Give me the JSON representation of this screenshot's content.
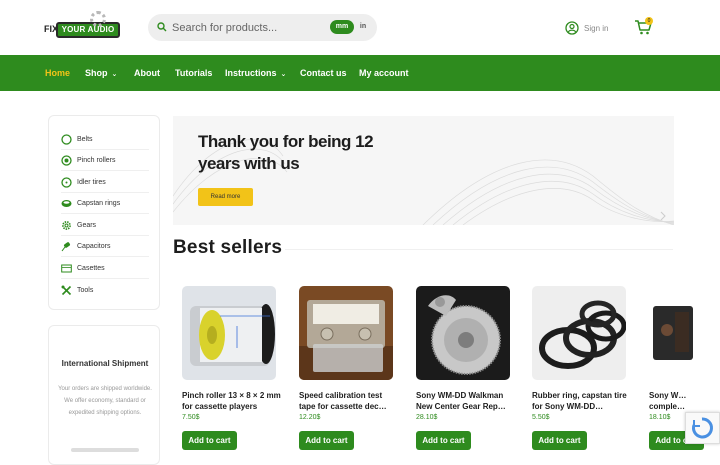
{
  "header": {
    "logo_fix": "FIX",
    "logo_brand": "YOUR AUDIO",
    "search_placeholder": "Search for products...",
    "unit_mm": "mm",
    "unit_in": "in",
    "signin_label": "Sign in",
    "cart_count": "0"
  },
  "nav": {
    "items": [
      {
        "label": "Home"
      },
      {
        "label": "Shop"
      },
      {
        "label": "About"
      },
      {
        "label": "Tutorials"
      },
      {
        "label": "Instructions"
      },
      {
        "label": "Contact us"
      },
      {
        "label": "My account"
      }
    ]
  },
  "sidebar": {
    "categories": [
      {
        "label": "Belts",
        "icon": "ring-icon"
      },
      {
        "label": "Pinch rollers",
        "icon": "roller-icon"
      },
      {
        "label": "Idler tires",
        "icon": "tire-icon"
      },
      {
        "label": "Capstan rings",
        "icon": "capstan-ring-icon"
      },
      {
        "label": "Gears",
        "icon": "gear-icon"
      },
      {
        "label": "Capacitors",
        "icon": "capacitor-icon"
      },
      {
        "label": "Casettes",
        "icon": "cassette-icon"
      },
      {
        "label": "Tools",
        "icon": "tools-icon"
      }
    ],
    "shipping_title": "International Shipment",
    "shipping_text": "Your orders are shipped worldwide. We offer economy, standard or expedited shipping options."
  },
  "banner": {
    "title": "Thank you for being 12 years with us",
    "button": "Read more"
  },
  "best_sellers": {
    "title": "Best sellers",
    "add_to_cart": "Add to cart",
    "products": [
      {
        "name": "Pinch roller 13 × 8 × 2 mm for cassette players",
        "price": "7.50$"
      },
      {
        "name": "Speed calibration test tape for cassette dec…",
        "price": "12.20$"
      },
      {
        "name": "Sony WM-DD Walkman New Center Gear Rep…",
        "price": "28.10$"
      },
      {
        "name": "Rubber ring, capstan tire for Sony WM-DD…",
        "price": "5.50$"
      },
      {
        "name": "Sony W… comple…",
        "price": "18.10$"
      }
    ]
  },
  "colors": {
    "brand_green": "#2e8b1e",
    "accent_yellow": "#f2c318"
  }
}
